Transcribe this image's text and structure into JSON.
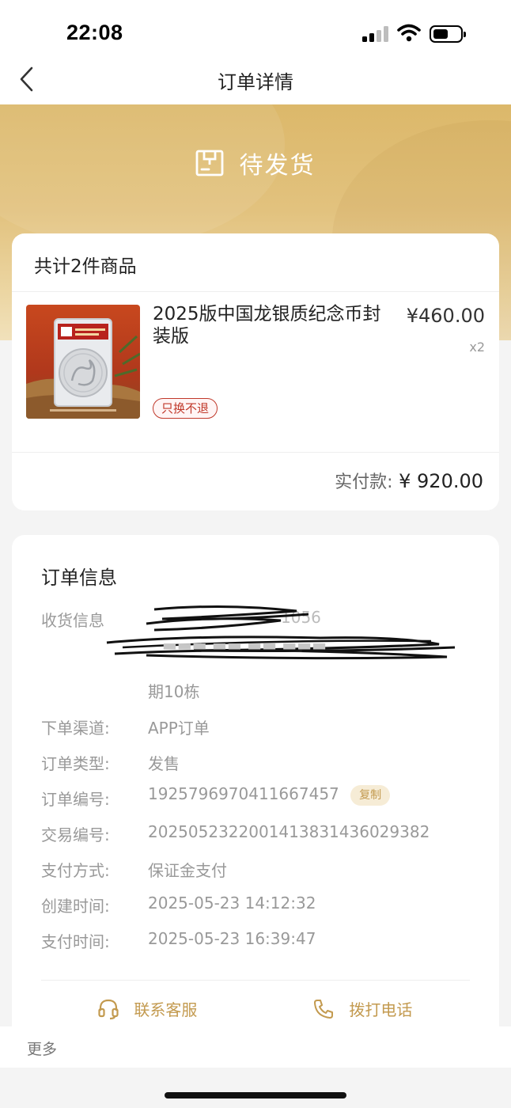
{
  "status_bar": {
    "time": "22:08"
  },
  "nav": {
    "title": "订单详情"
  },
  "order_status": {
    "label": "待发货",
    "icon": "package-icon"
  },
  "goods": {
    "header": "共计2件商品",
    "items": [
      {
        "name": "2025版中国龙银质纪念币封装版",
        "price": "¥460.00",
        "qty": "x2",
        "tag": "只换不退"
      }
    ],
    "paid_label": "实付款:",
    "paid_amount": "¥ 920.00"
  },
  "order_info": {
    "title": "订单信息",
    "shipping_label": "收货信息",
    "shipping_phone_tail": "1056",
    "shipping_address_tail": "期10栋",
    "rows": [
      {
        "label": "下单渠道:",
        "value": "APP订单"
      },
      {
        "label": "订单类型:",
        "value": "发售"
      },
      {
        "label": "订单编号:",
        "value": "1925796970411667457",
        "action": "复制"
      },
      {
        "label": "交易编号:",
        "value": "2025052322001413831436029382"
      },
      {
        "label": "支付方式:",
        "value": "保证金支付"
      },
      {
        "label": "创建时间:",
        "value": "2025-05-23 14:12:32"
      },
      {
        "label": "支付时间:",
        "value": "2025-05-23 16:39:47"
      }
    ],
    "contact_service": "联系客服",
    "call_phone": "拨打电话"
  },
  "footer": {
    "more": "更多"
  },
  "colors": {
    "gold": "#c39a4f",
    "hero": "#dcb86a",
    "tag_red": "#c0392b"
  }
}
